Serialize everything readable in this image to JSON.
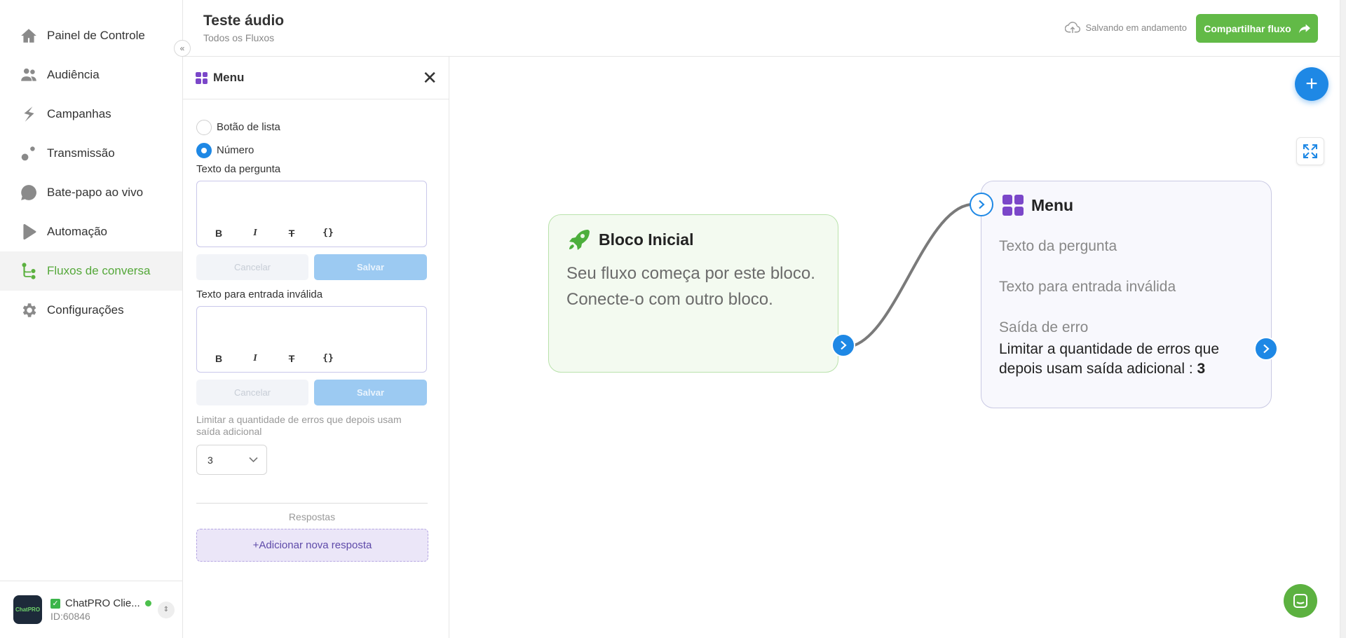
{
  "sidebar": {
    "items": [
      {
        "label": "Painel de Controle",
        "icon": "home-icon"
      },
      {
        "label": "Audiência",
        "icon": "people-icon"
      },
      {
        "label": "Campanhas",
        "icon": "bolt-icon"
      },
      {
        "label": "Transmissão",
        "icon": "broadcast-icon"
      },
      {
        "label": "Bate-papo ao vivo",
        "icon": "chat-bubble-icon"
      },
      {
        "label": "Automação",
        "icon": "play-icon"
      },
      {
        "label": "Fluxos de conversa",
        "icon": "flow-icon"
      },
      {
        "label": "Configurações",
        "icon": "gear-icon"
      }
    ],
    "active": "Fluxos de conversa",
    "account": {
      "name": "ChatPRO Clie...",
      "id": "ID:60846",
      "avatar_text": "ChatPRO"
    }
  },
  "header": {
    "title": "Teste áudio",
    "subtitle": "Todos os Fluxos",
    "status": "Salvando em andamento",
    "share_label": "Compartilhar fluxo"
  },
  "panel": {
    "title": "Menu",
    "options": [
      {
        "label": "Botão de lista",
        "checked": false
      },
      {
        "label": "Número",
        "checked": true
      }
    ],
    "question_label": "Texto da pergunta",
    "invalid_label": "Texto para entrada inválida",
    "toolbar": {
      "bold": "B",
      "italic": "I",
      "strike": "T",
      "code": "{}"
    },
    "cancel_label": "Cancelar",
    "save_label": "Salvar",
    "limit_label": "Limitar a quantidade de erros que depois usam saída adicional",
    "limit_value": "3",
    "answers_label": "Respostas",
    "add_answer_label": "+Adicionar nova resposta"
  },
  "canvas": {
    "start_node": {
      "title": "Bloco Inicial",
      "line1": "Seu fluxo começa por este bloco.",
      "line2": "Conecte-o com outro bloco."
    },
    "menu_node": {
      "title": "Menu",
      "question": "Texto da pergunta",
      "invalid": "Texto para entrada inválida",
      "error_exit": "Saída de erro",
      "limit_text": "Limitar a quantidade de erros que depois usam saída adicional : ",
      "limit_value": "3"
    }
  },
  "colors": {
    "accent": "#1e88e5",
    "brand_green": "#62ba47",
    "menu_purple": "#7b47c9"
  }
}
